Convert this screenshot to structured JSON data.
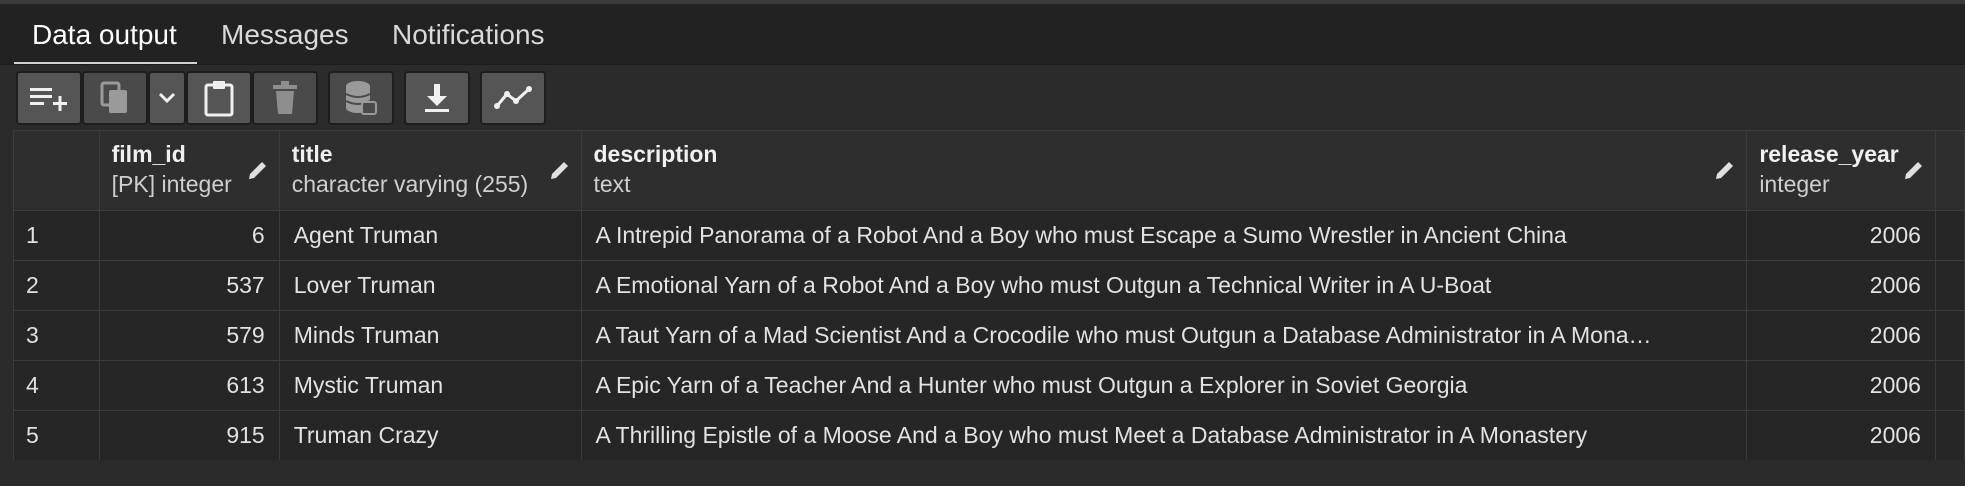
{
  "tabs": [
    {
      "label": "Data output",
      "active": true
    },
    {
      "label": "Messages",
      "active": false
    },
    {
      "label": "Notifications",
      "active": false
    }
  ],
  "toolbar": {
    "buttons": [
      {
        "icon": "add-row-icon",
        "enabled": true
      },
      {
        "icon": "copy-icon",
        "enabled": false
      },
      {
        "icon": "chevron-down-icon",
        "enabled": true
      },
      {
        "icon": "paste-icon",
        "enabled": true
      },
      {
        "icon": "trash-icon",
        "enabled": false
      },
      {
        "icon": "save-data-icon",
        "enabled": false
      },
      {
        "icon": "download-icon",
        "enabled": true
      },
      {
        "icon": "graph-icon",
        "enabled": true
      }
    ]
  },
  "grid": {
    "columns": [
      {
        "name": "film_id",
        "type": "[PK] integer"
      },
      {
        "name": "title",
        "type": "character varying (255)"
      },
      {
        "name": "description",
        "type": "text"
      },
      {
        "name": "release_year",
        "type": "integer"
      }
    ],
    "rows": [
      {
        "num": "1",
        "film_id": "6",
        "title": "Agent Truman",
        "description": "A Intrepid Panorama of a Robot And a Boy who must Escape a Sumo Wrestler in Ancient China",
        "release_year": "2006"
      },
      {
        "num": "2",
        "film_id": "537",
        "title": "Lover Truman",
        "description": "A Emotional Yarn of a Robot And a Boy who must Outgun a Technical Writer in A U-Boat",
        "release_year": "2006"
      },
      {
        "num": "3",
        "film_id": "579",
        "title": "Minds Truman",
        "description": "A Taut Yarn of a Mad Scientist And a Crocodile who must Outgun a Database Administrator in A Mona…",
        "release_year": "2006"
      },
      {
        "num": "4",
        "film_id": "613",
        "title": "Mystic Truman",
        "description": "A Epic Yarn of a Teacher And a Hunter who must Outgun a Explorer in Soviet Georgia",
        "release_year": "2006"
      },
      {
        "num": "5",
        "film_id": "915",
        "title": "Truman Crazy",
        "description": "A Thrilling Epistle of a Moose And a Boy who must Meet a Database Administrator in A Monastery",
        "release_year": "2006"
      }
    ]
  },
  "colors": {
    "background": "#2b2b2b",
    "header_bg": "#2e2e2e",
    "button_bg": "#555555",
    "grid_line": "#3c3c3c"
  }
}
